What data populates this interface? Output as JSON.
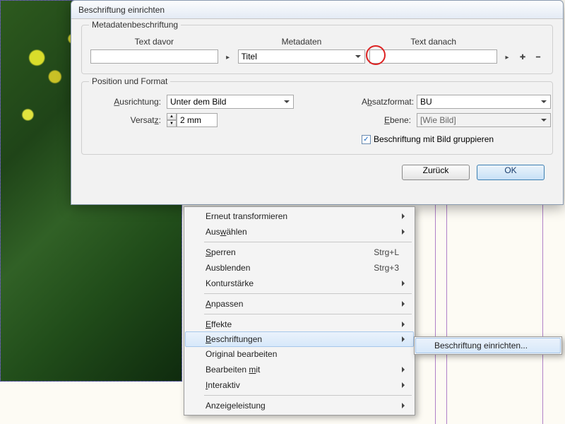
{
  "dialog": {
    "title": "Beschriftung einrichten",
    "group1_title": "Metadatenbeschriftung",
    "col1_label": "Text davor",
    "col2_label": "Metadaten",
    "col3_label": "Text danach",
    "metadata_value": "Titel",
    "group2_title": "Position und Format",
    "ausrichtung_label": "Ausrichtung:",
    "ausrichtung_value": "Unter dem Bild",
    "versatz_label": "Versatz:",
    "versatz_value": "2 mm",
    "absatzformat_label": "Absatzformat:",
    "absatzformat_value": "BU",
    "ebene_label": "Ebene:",
    "ebene_value": "[Wie Bild]",
    "checkbox_label": "Beschriftung mit Bild gruppieren",
    "btn_back": "Zurück",
    "btn_ok": "OK"
  },
  "menu": {
    "items": [
      {
        "label": "Erneut transformieren",
        "arrow": true
      },
      {
        "label": "Auswählen",
        "mnemonic": "w",
        "arrow": true
      },
      {
        "sep": true
      },
      {
        "label": "Sperren",
        "mnemonic": "S",
        "shortcut": "Strg+L"
      },
      {
        "label": "Ausblenden",
        "shortcut": "Strg+3"
      },
      {
        "label": "Konturstärke",
        "arrow": true
      },
      {
        "sep": true
      },
      {
        "label": "Anpassen",
        "mnemonic": "A",
        "arrow": true
      },
      {
        "sep": true
      },
      {
        "label": "Effekte",
        "mnemonic": "E",
        "arrow": true
      },
      {
        "label": "Beschriftungen",
        "mnemonic": "B",
        "arrow": true,
        "highlight": true
      },
      {
        "label": "Original bearbeiten"
      },
      {
        "label": "Bearbeiten mit",
        "mnemonic": "m",
        "arrow": true
      },
      {
        "label": "Interaktiv",
        "mnemonic": "I",
        "arrow": true
      },
      {
        "sep": true
      },
      {
        "label": "Anzeigeleistung",
        "arrow": true
      }
    ],
    "submenu_item": "Beschriftung einrichten..."
  }
}
